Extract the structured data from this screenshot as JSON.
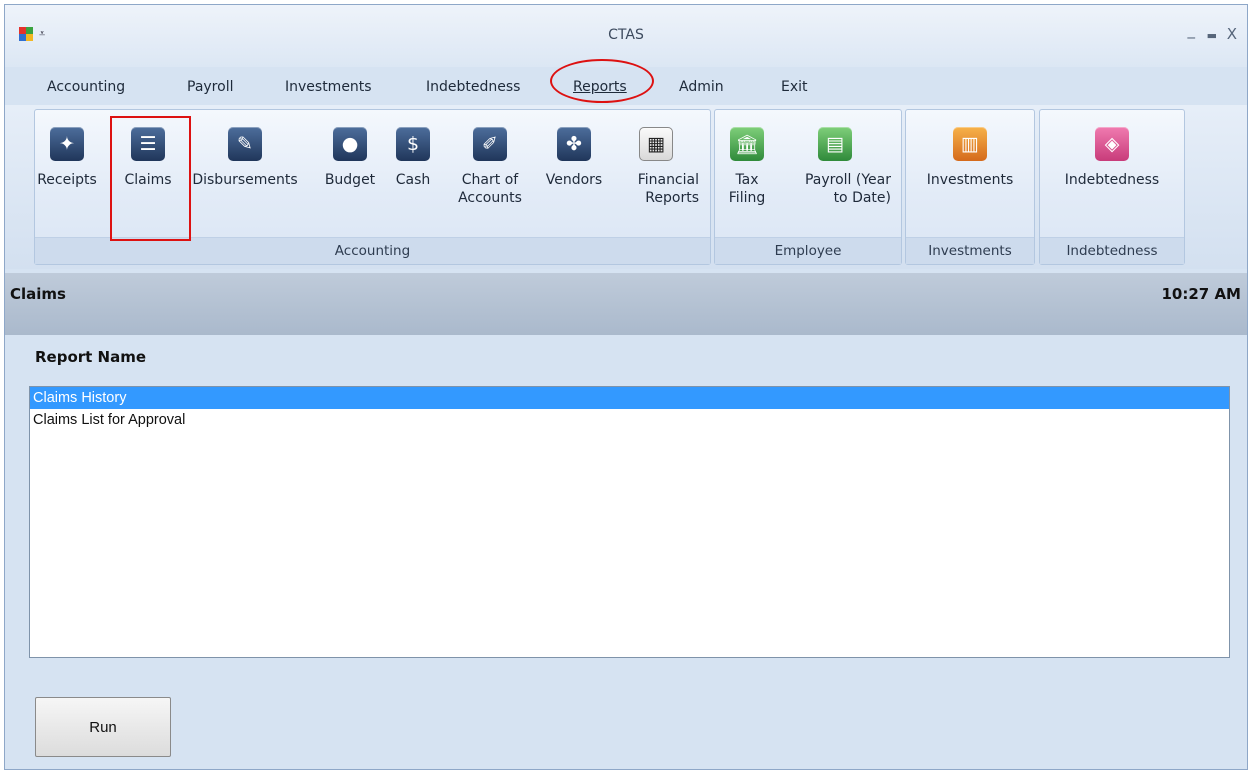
{
  "window": {
    "title": "CTAS",
    "qat_glyph": "⩡",
    "minimize": "_",
    "maximize": "▬",
    "close": "X"
  },
  "menu": {
    "tabs": [
      "Accounting",
      "Payroll",
      "Investments",
      "Indebtedness",
      "Reports",
      "Admin",
      "Exit"
    ],
    "active": "Reports"
  },
  "ribbon": {
    "groups": [
      {
        "label": "Accounting"
      },
      {
        "label": "Employee"
      },
      {
        "label": "Investments"
      },
      {
        "label": "Indebtedness"
      }
    ],
    "buttons": [
      {
        "label": "Receipts",
        "icon": "receipts-icon",
        "color": "#2c4a78"
      },
      {
        "label": "Claims",
        "icon": "claims-icon",
        "color": "#2c4a78"
      },
      {
        "label": "Disbursements",
        "icon": "disbursements-icon",
        "color": "#2c4a78"
      },
      {
        "label": "Budget",
        "icon": "piggy-bank-icon",
        "color": "#2c4a78"
      },
      {
        "label": "Cash",
        "icon": "cash-icon",
        "color": "#2c4a78"
      },
      {
        "label": "Chart of\nAccounts",
        "icon": "chart-of-accounts-icon",
        "color": "#2c4a78"
      },
      {
        "label": "Vendors",
        "icon": "handshake-icon",
        "color": "#2c4a78"
      },
      {
        "label": "Financial\nReports",
        "icon": "calculator-icon",
        "color": "#333333"
      },
      {
        "label": "Tax\nFiling",
        "icon": "bank-building-icon",
        "color": "#3b9a44"
      },
      {
        "label": "Payroll (Year\nto Date)",
        "icon": "payroll-document-icon",
        "color": "#3b9a44"
      },
      {
        "label": "Investments",
        "icon": "investments-chart-icon",
        "color": "#e8892c"
      },
      {
        "label": "Indebtedness",
        "icon": "indebtedness-icon",
        "color": "#d84f8e"
      }
    ]
  },
  "strip": {
    "title": "Claims",
    "time": "10:27 AM"
  },
  "report": {
    "header": "Report Name",
    "items": [
      "Claims History",
      "Claims List for Approval"
    ],
    "selected_index": 0
  },
  "run_label": "Run",
  "annotation_color": "#dd1111"
}
